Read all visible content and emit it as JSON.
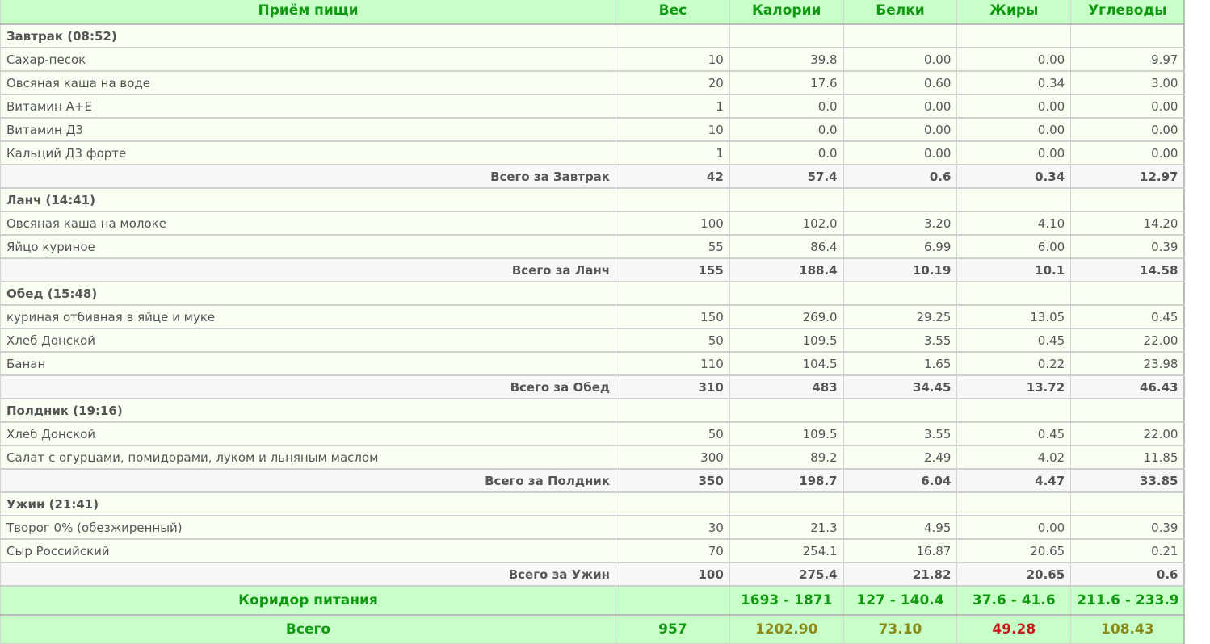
{
  "columns": [
    "Приём пищи",
    "Вес",
    "Калории",
    "Белки",
    "Жиры",
    "Углеводы"
  ],
  "meals": [
    {
      "title": "Завтрак (08:52)",
      "items": [
        [
          "Сахар-песок",
          "10",
          "39.8",
          "0.00",
          "0.00",
          "9.97"
        ],
        [
          "Овсяная каша на воде",
          "20",
          "17.6",
          "0.60",
          "0.34",
          "3.00"
        ],
        [
          "Витамин А+Е",
          "1",
          "0.0",
          "0.00",
          "0.00",
          "0.00"
        ],
        [
          "Витамин Д3",
          "10",
          "0.0",
          "0.00",
          "0.00",
          "0.00"
        ],
        [
          "Кальций Д3 форте",
          "1",
          "0.0",
          "0.00",
          "0.00",
          "0.00"
        ]
      ],
      "total": [
        "Всего за Завтрак",
        "42",
        "57.4",
        "0.6",
        "0.34",
        "12.97"
      ]
    },
    {
      "title": "Ланч (14:41)",
      "items": [
        [
          "Овсяная каша на молоке",
          "100",
          "102.0",
          "3.20",
          "4.10",
          "14.20"
        ],
        [
          "Яйцо куриное",
          "55",
          "86.4",
          "6.99",
          "6.00",
          "0.39"
        ]
      ],
      "total": [
        "Всего за Ланч",
        "155",
        "188.4",
        "10.19",
        "10.1",
        "14.58"
      ]
    },
    {
      "title": "Обед (15:48)",
      "items": [
        [
          "куриная отбивная в яйце и муке",
          "150",
          "269.0",
          "29.25",
          "13.05",
          "0.45"
        ],
        [
          "Хлеб Донской",
          "50",
          "109.5",
          "3.55",
          "0.45",
          "22.00"
        ],
        [
          "Банан",
          "110",
          "104.5",
          "1.65",
          "0.22",
          "23.98"
        ]
      ],
      "total": [
        "Всего за Обед",
        "310",
        "483",
        "34.45",
        "13.72",
        "46.43"
      ]
    },
    {
      "title": "Полдник (19:16)",
      "items": [
        [
          "Хлеб Донской",
          "50",
          "109.5",
          "3.55",
          "0.45",
          "22.00"
        ],
        [
          "Салат с огурцами, помидорами, луком и льняным маслом",
          "300",
          "89.2",
          "2.49",
          "4.02",
          "11.85"
        ]
      ],
      "total": [
        "Всего за Полдник",
        "350",
        "198.7",
        "6.04",
        "4.47",
        "33.85"
      ]
    },
    {
      "title": "Ужин (21:41)",
      "items": [
        [
          "Творог 0% (обезжиренный)",
          "30",
          "21.3",
          "4.95",
          "0.00",
          "0.39"
        ],
        [
          "Сыр Российский",
          "70",
          "254.1",
          "16.87",
          "20.65",
          "0.21"
        ]
      ],
      "total": [
        "Всего за Ужин",
        "100",
        "275.4",
        "21.82",
        "20.65",
        "0.6"
      ]
    }
  ],
  "corridor": [
    "Коридор питания",
    "",
    "1693 - 1871",
    "127 - 140.4",
    "37.6 - 41.6",
    "211.6 - 233.9"
  ],
  "grand_total": [
    "Всего",
    "957",
    "1202.90",
    "73.10",
    "49.28",
    "108.43"
  ],
  "colors": {
    "header_bg": "#c8ffc8",
    "header_text": "#119911",
    "ok_olive": "#8a8a1a",
    "over_red": "#c81818"
  }
}
